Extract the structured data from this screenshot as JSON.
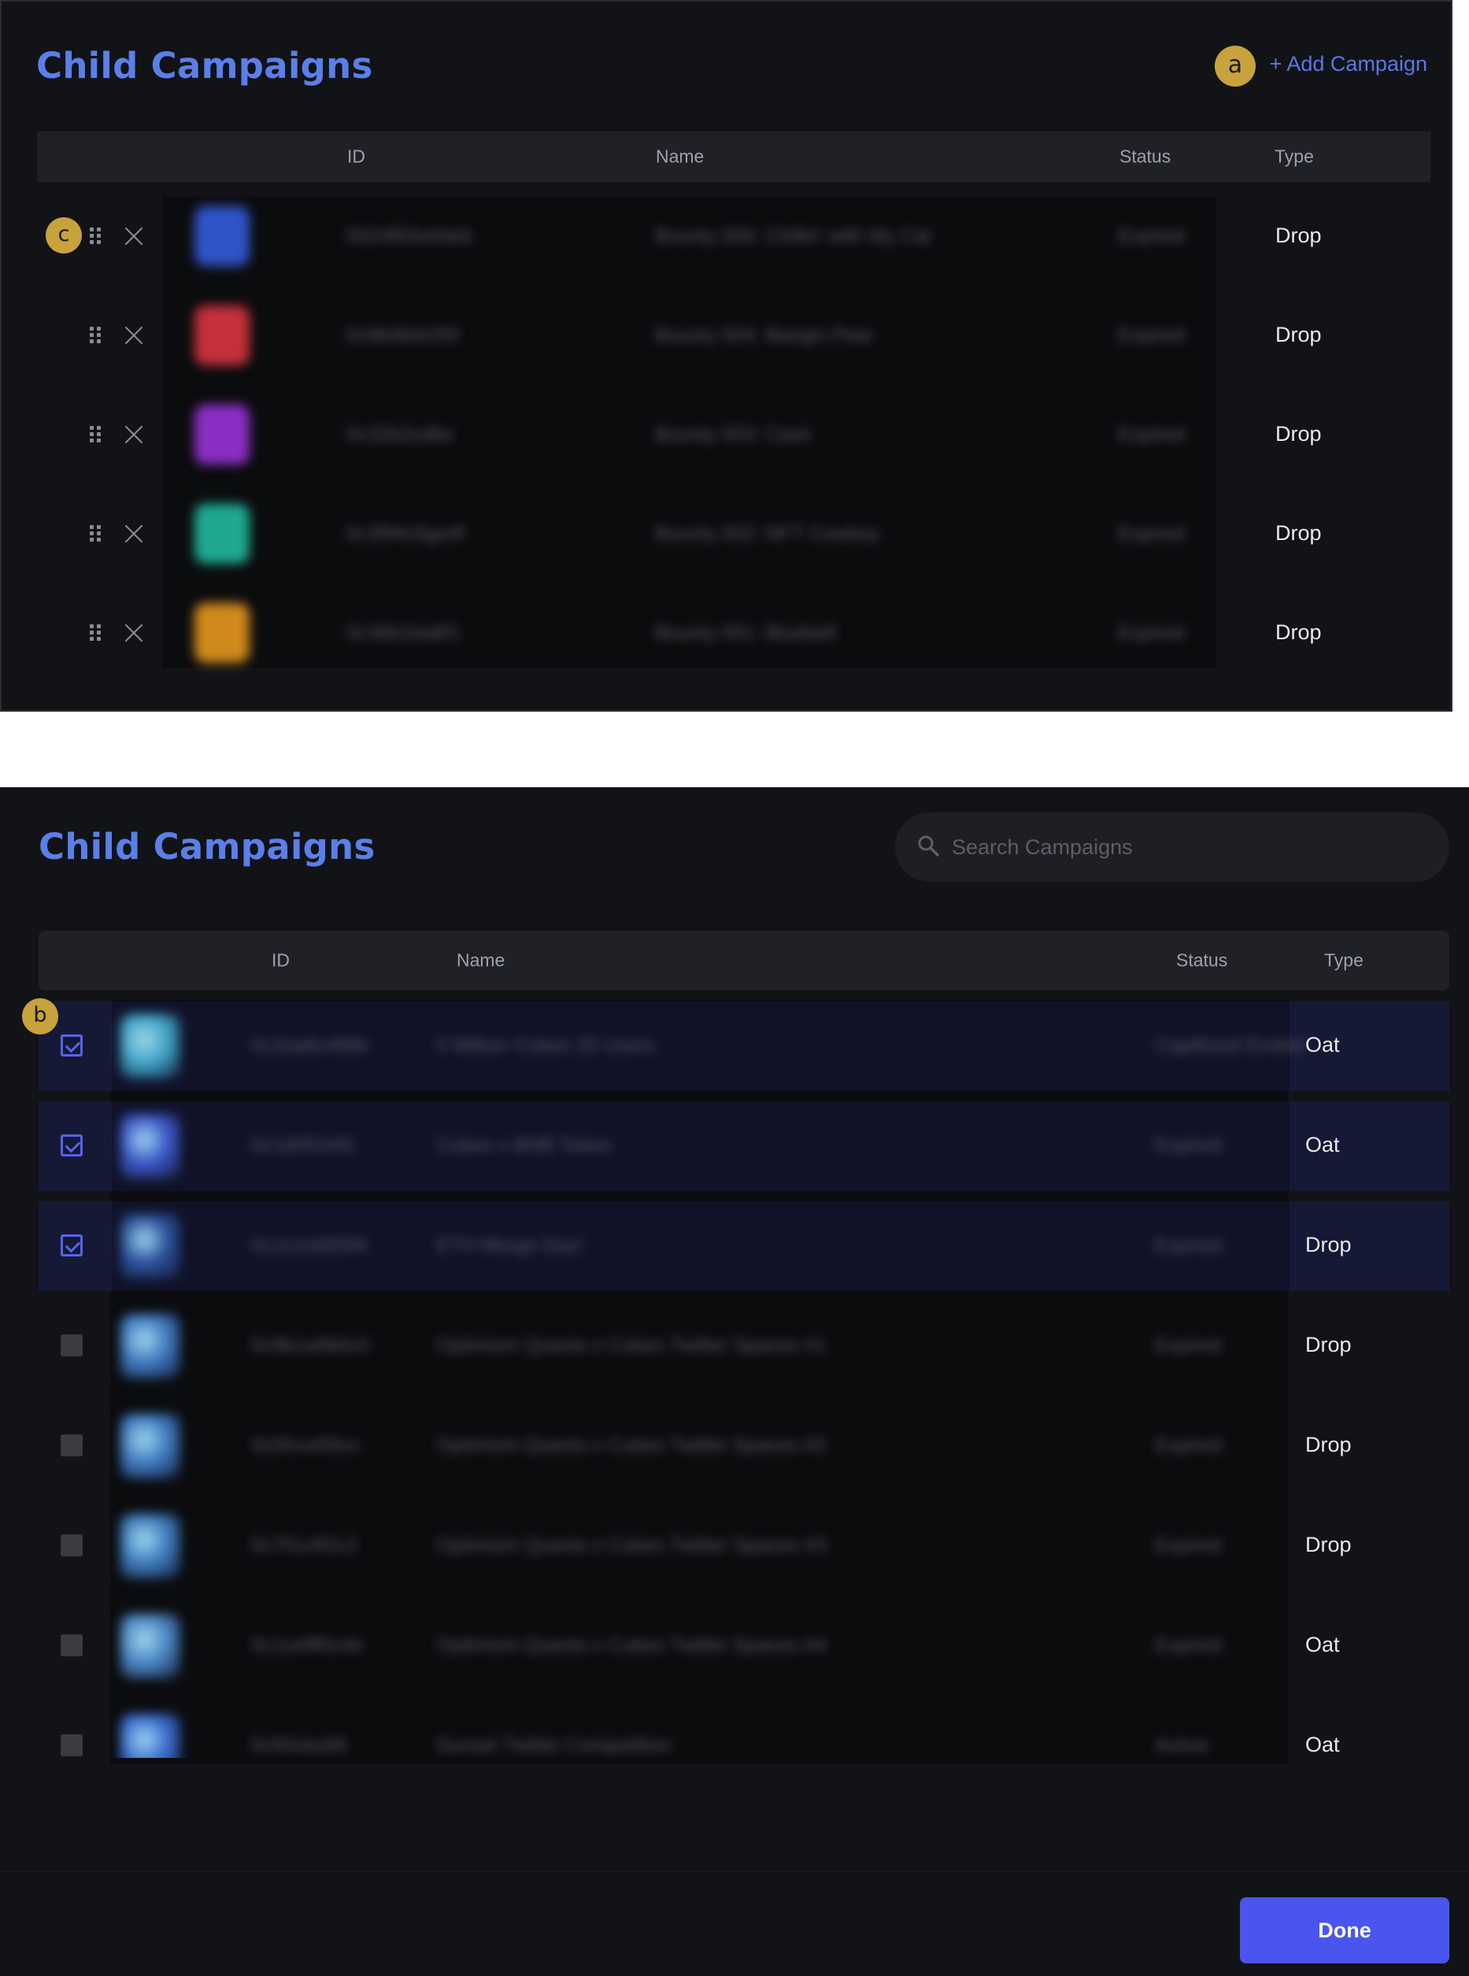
{
  "panel1": {
    "title": "Child Campaigns",
    "add_campaign_label": "+ Add Campaign",
    "annotations": {
      "a": "a",
      "c": "c"
    },
    "columns": {
      "id": "ID",
      "name": "Name",
      "status": "Status",
      "type": "Type"
    },
    "rows": [
      {
        "id": "0024f65e44eb",
        "name": "Bounty 006: Chillin' with My Cat",
        "status": "Expired",
        "type": "Drop",
        "thumb_color": "#2f54c8"
      },
      {
        "id": "0c9b0b0c05f",
        "name": "Bounty 004: Bangin Pear",
        "status": "Expired",
        "type": "Drop",
        "thumb_color": "#c5303a"
      },
      {
        "id": "0c32b2cd6e",
        "name": "Bounty 003: Cash",
        "status": "Expired",
        "type": "Drop",
        "thumb_color": "#8a2fc4"
      },
      {
        "id": "0c3f94c6ga4f",
        "name": "Bounty 002: NFT Cowboy",
        "status": "Expired",
        "type": "Drop",
        "thumb_color": "#1fa98f"
      },
      {
        "id": "0c36b1ba8f1",
        "name": "Bounty 001: Bluebell",
        "status": "Expired",
        "type": "Drop",
        "thumb_color": "#d08a1c"
      }
    ]
  },
  "panel2": {
    "title": "Child Campaigns",
    "search_placeholder": "Search Campaigns",
    "annotations": {
      "b": "b"
    },
    "columns": {
      "id": "ID",
      "name": "Name",
      "status": "Status",
      "type": "Type"
    },
    "rows": [
      {
        "checked": true,
        "id": "0c1ba6c498e",
        "name": "0 Million Cubes 25 Users",
        "status": "Capitlized Ended",
        "type": "Oat",
        "thumb_color": "#3fa4c6"
      },
      {
        "checked": true,
        "id": "0c1d0f2445",
        "name": "Cubes x BNB Token",
        "status": "Expired",
        "type": "Oat",
        "thumb_color": "#3a56c8"
      },
      {
        "checked": true,
        "id": "0c1cccb6594",
        "name": "ETH Merge Day!",
        "status": "Expired",
        "type": "Drop",
        "thumb_color": "#2a4f9a"
      },
      {
        "checked": false,
        "id": "0c9b1a0b0c0",
        "name": "Optimism Quests x Cubes Twitter Spaces #1",
        "status": "Expired",
        "type": "Drop",
        "thumb_color": "#3f78c0"
      },
      {
        "checked": false,
        "id": "0c5fcce56cc",
        "name": "Optimism Quests x Cubes Twitter Spaces #2",
        "status": "Expired",
        "type": "Drop",
        "thumb_color": "#3f7ac2"
      },
      {
        "checked": false,
        "id": "0c7f1c4f2c2",
        "name": "Optimism Quests x Cubes Twitter Spaces #3",
        "status": "Expired",
        "type": "Drop",
        "thumb_color": "#3e7cbe"
      },
      {
        "checked": false,
        "id": "0c1ce9f0c4e",
        "name": "Optimism Quests x Cubes Twitter Spaces #4",
        "status": "Expired",
        "type": "Oat",
        "thumb_color": "#4a86c4"
      },
      {
        "checked": false,
        "id": "0c50cbcb9",
        "name": "Sunset Twitter Competition",
        "status": "Active",
        "type": "Oat",
        "thumb_color": "#3a6ad0"
      }
    ],
    "done_label": "Done"
  }
}
